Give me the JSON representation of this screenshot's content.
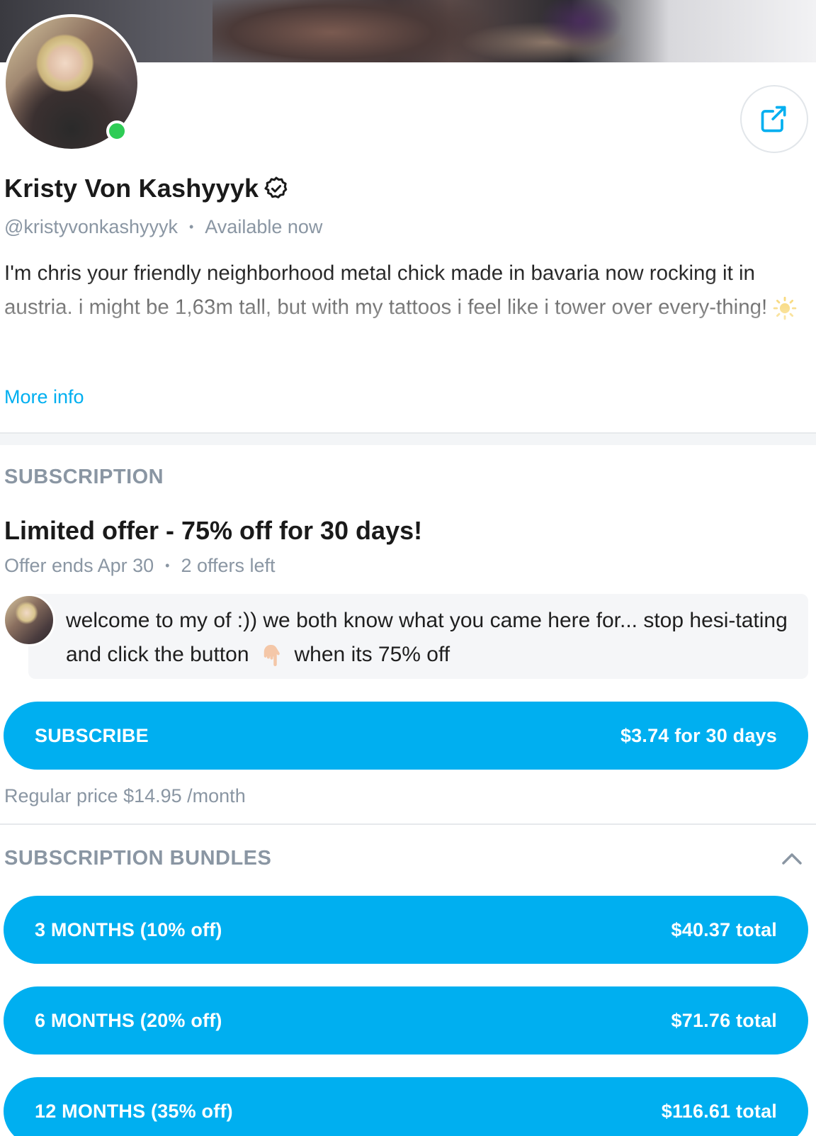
{
  "profile": {
    "name": "Kristy Von Kashyyyk",
    "handle": "@kristyvonkashyyyk",
    "status": "Available now",
    "bio": "I'm chris your friendly neighborhood metal chick made in bavaria now rocking it in austria. i might be 1,63m tall, but with my tattoos i feel like i tower over every-thing!",
    "more_info": "More info"
  },
  "subscription": {
    "section_title": "SUBSCRIPTION",
    "offer_title": "Limited offer - 75% off for 30 days!",
    "offer_ends": "Offer ends Apr 30",
    "offers_left": "2 offers left",
    "message_part1": "welcome to my of :)) we both know what you came here for... stop hesi-tating and click the button",
    "message_part2": "when its 75% off",
    "subscribe_label": "SUBSCRIBE",
    "subscribe_price": "$3.74 for 30 days",
    "regular_price": "Regular price $14.95 /month"
  },
  "bundles": {
    "section_title": "SUBSCRIPTION BUNDLES",
    "items": [
      {
        "label": "3 MONTHS (10% off)",
        "price": "$40.37 total"
      },
      {
        "label": "6 MONTHS (20% off)",
        "price": "$71.76 total"
      },
      {
        "label": "12 MONTHS (35% off)",
        "price": "$116.61 total"
      }
    ]
  },
  "colors": {
    "accent": "#00aff0",
    "online": "#2ecc55",
    "muted_text": "#8a96a3"
  },
  "icons": [
    "share-icon",
    "verified-icon",
    "sun-emoji-icon",
    "pointing-hand-emoji-icon",
    "chevron-up-icon"
  ]
}
